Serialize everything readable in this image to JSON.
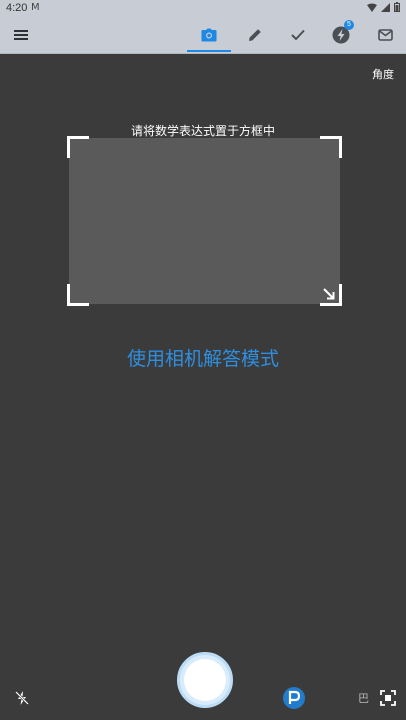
{
  "status_bar": {
    "time": "4:20",
    "notification_glyph": "M"
  },
  "toolbar": {
    "menu_icon": "menu-icon",
    "tabs": [
      {
        "icon": "camera-icon",
        "active": true
      },
      {
        "icon": "pencil-icon",
        "active": false
      },
      {
        "icon": "check-icon",
        "active": false
      },
      {
        "icon": "lightning-icon",
        "active": false,
        "badge": "5"
      },
      {
        "icon": "mail-icon",
        "active": false
      }
    ]
  },
  "camera": {
    "angle_label": "角度",
    "instruction": "请将数学表达式置于方框中",
    "mode_title": "使用相机解答模式",
    "watermark_text": "巴"
  },
  "colors": {
    "accent": "#1e88e5",
    "mode_title": "#2e8fe0",
    "background": "#3b3b3b",
    "toolbar": "#c8ccd4",
    "frame_fill": "#5a5a5a"
  }
}
